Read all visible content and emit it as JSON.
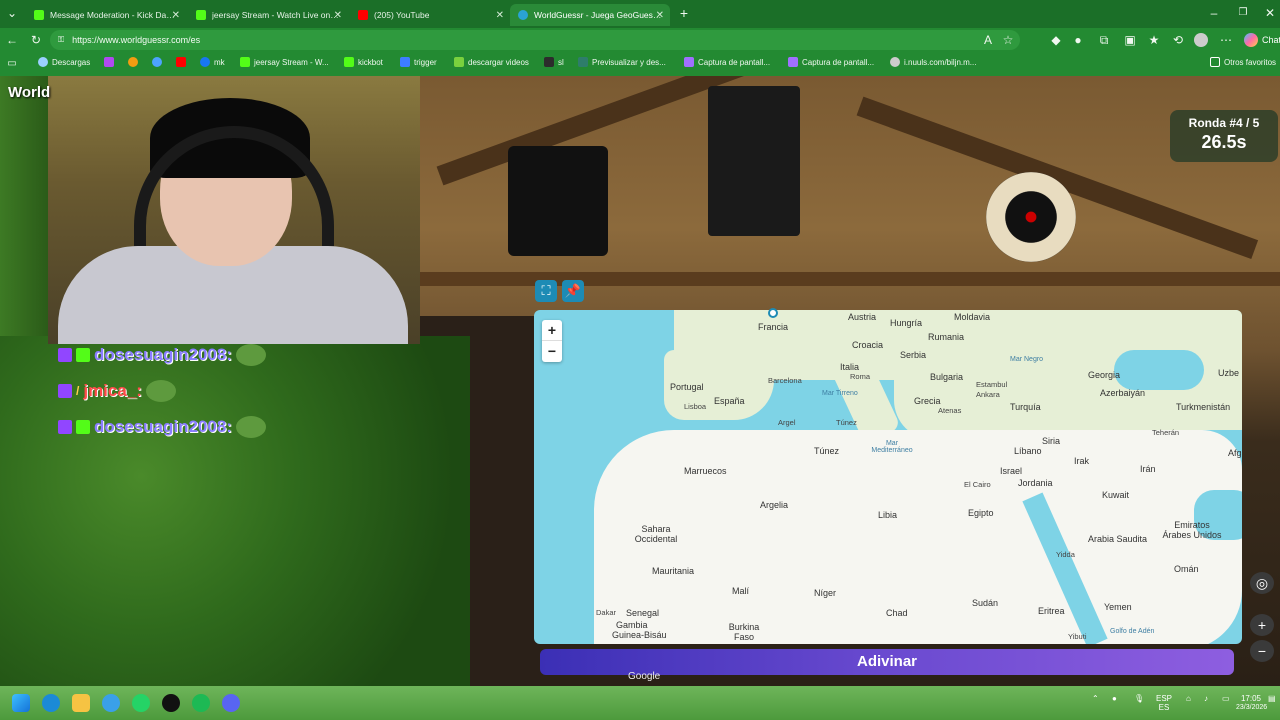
{
  "tabs": [
    {
      "title": "Message Moderation - Kick Dashb",
      "color": "#53fc18",
      "active": false
    },
    {
      "title": "jeersay Stream - Watch Live on Ki",
      "color": "#53fc18",
      "active": false
    },
    {
      "title": "(205) YouTube",
      "color": "#ff0000",
      "active": false
    },
    {
      "title": "WorldGuessr - Juega GeoGuessr g",
      "color": "#2aa3d4",
      "active": true
    }
  ],
  "tab_new": "+",
  "address": {
    "url": "https://www.worldguessr.com/es",
    "copilot": "Chat"
  },
  "bookmarks": [
    {
      "label": "Descargas",
      "color": "#9bd0ff"
    },
    {
      "label": "",
      "color": "#b04af0"
    },
    {
      "label": "",
      "color": "#f39c12"
    },
    {
      "label": "",
      "color": "#4da3ff"
    },
    {
      "label": "",
      "color": "#ff0000"
    },
    {
      "label": "mk",
      "color": "#1877f2"
    },
    {
      "label": "jeersay Stream - W...",
      "color": "#53fc18"
    },
    {
      "label": "kickbot",
      "color": "#53fc18"
    },
    {
      "label": "trigger",
      "color": "#3d7dff"
    },
    {
      "label": "descargar videos",
      "color": "#7ad13e"
    },
    {
      "label": "sl",
      "color": "#2c2c2c"
    },
    {
      "label": "Previsualizar y des...",
      "color": "#2e7d6b"
    },
    {
      "label": "Captura de pantall...",
      "color": "#a070ff"
    },
    {
      "label": "Captura de pantall...",
      "color": "#a070ff"
    },
    {
      "label": "i.nuuls.com/biljn.m...",
      "color": "#cccccc"
    }
  ],
  "other_bookmarks": "Otros favoritos",
  "overlay": {
    "world_label": "World"
  },
  "chat": [
    {
      "user": "dosesuagin2008:",
      "color": "#8a7dff"
    },
    {
      "user": "jmica_:",
      "color": "#ff4a4a"
    },
    {
      "user": "dosesuagin2008:",
      "color": "#8a7dff"
    }
  ],
  "game": {
    "round": "Ronda #4 / 5",
    "timer": "26.5s",
    "guess_button": "Adivinar",
    "attribution": "Google"
  },
  "map": {
    "zoom_in": "+",
    "zoom_out": "−",
    "countries": [
      "Francia",
      "Austria",
      "Hungría",
      "Moldavia",
      "Croacia",
      "Rumania",
      "Serbia",
      "Italia",
      "Bulgaria",
      "Portugal",
      "España",
      "Georgia",
      "Azerbaiyán",
      "Turquía",
      "Grecia",
      "Turkmenistán",
      "Siria",
      "Líbano",
      "Irak",
      "Irán",
      "Israel",
      "Jordania",
      "Kuwait",
      "Marruecos",
      "Túnez",
      "Argelia",
      "Libia",
      "Egipto",
      "Arabia Saudita",
      "Emiratos Árabes Unidos",
      "Sahara Occidental",
      "Mauritania",
      "Malí",
      "Níger",
      "Chad",
      "Sudán",
      "Omán",
      "Yemen",
      "Eritrea",
      "Senegal",
      "Gambia",
      "Guinea-Bisáu",
      "Burkina Faso",
      "Uzbe",
      "Afg"
    ],
    "cities": [
      "Roma",
      "Barcelona",
      "Lisboa",
      "Argel",
      "Túnez",
      "Estambul",
      "Ankara",
      "Atenas",
      "Teherán",
      "El Cairo",
      "Yidda",
      "Dakar",
      "Yibuti"
    ],
    "seas": [
      "Mar Negro",
      "Mar Tirreno",
      "Mar Mediterráneo",
      "Golfo de Adén"
    ]
  },
  "taskbar": {
    "lang": "ESP",
    "lang2": "ES",
    "time": "17:05",
    "date": "23/3/2026"
  }
}
